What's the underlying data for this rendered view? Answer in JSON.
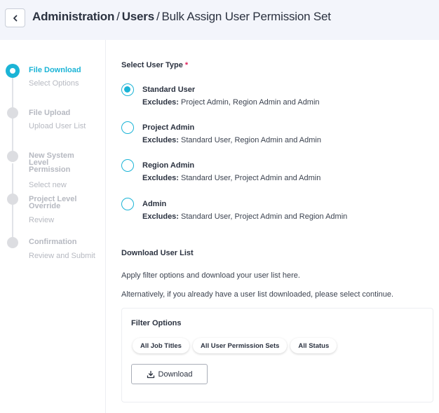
{
  "header": {
    "crumbs": [
      "Administration",
      "Users"
    ],
    "separator": "/",
    "current": "Bulk Assign User Permission Set"
  },
  "stepper": {
    "steps": [
      {
        "title": "File Download",
        "subtitle": "Select Options",
        "status": "active"
      },
      {
        "title": "File Upload",
        "subtitle": "Upload User List",
        "status": "pending"
      },
      {
        "title": "New System Level Permission",
        "subtitle": "Select new",
        "status": "pending"
      },
      {
        "title": "Project Level Override",
        "subtitle": "Review",
        "status": "pending"
      },
      {
        "title": "Confirmation",
        "subtitle": "Review and Submit",
        "status": "pending"
      }
    ]
  },
  "user_type": {
    "label": "Select User Type",
    "required_mark": "*",
    "excludes_label": "Excludes:",
    "options": [
      {
        "title": "Standard User",
        "excludes": "Project Admin, Region Admin and Admin",
        "selected": true
      },
      {
        "title": "Project Admin",
        "excludes": "Standard User, Region Admin and Admin",
        "selected": false
      },
      {
        "title": "Region Admin",
        "excludes": "Standard User, Project Admin and Admin",
        "selected": false
      },
      {
        "title": "Admin",
        "excludes": "Standard User, Project Admin and Region Admin",
        "selected": false
      }
    ]
  },
  "download_section": {
    "title": "Download User List",
    "line1": "Apply filter options and download your user list here.",
    "line2": "Alternatively, if you already have a user list downloaded, please select continue."
  },
  "filters": {
    "title": "Filter Options",
    "chips": [
      "All Job Titles",
      "All User Permission Sets",
      "All Status"
    ],
    "download_label": "Download"
  },
  "colors": {
    "accent": "#1bb4d6",
    "required": "#e0245e",
    "inactive": "#b6b9c1",
    "header_bg": "#f3f5fb"
  }
}
